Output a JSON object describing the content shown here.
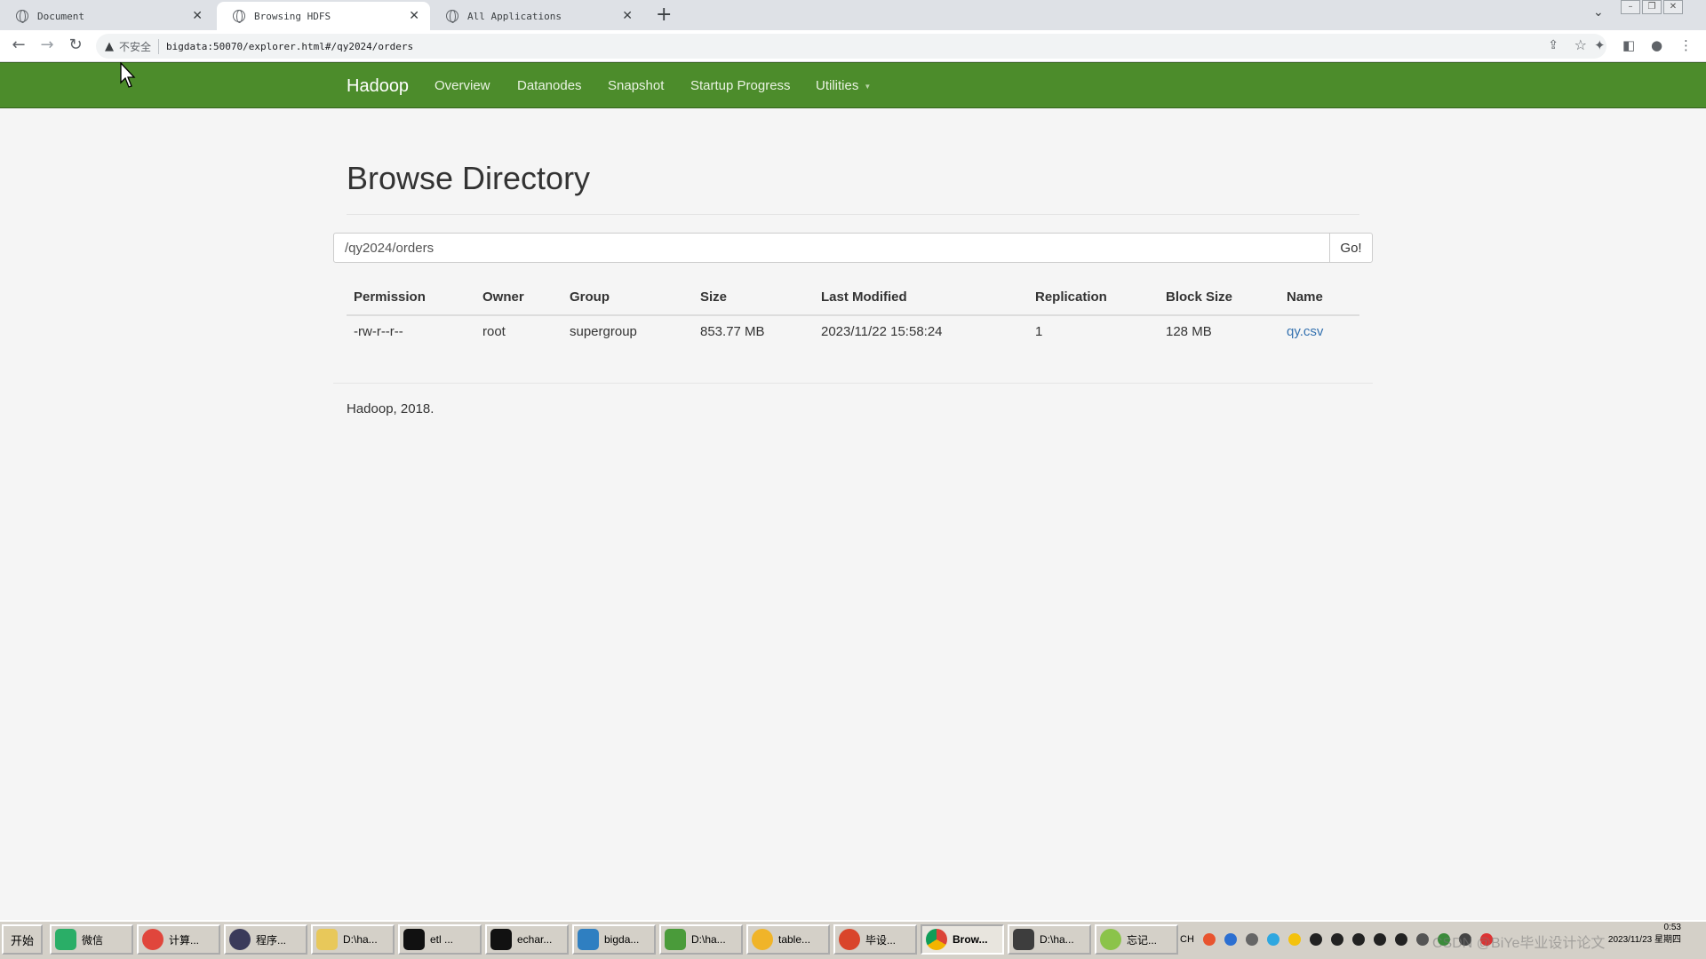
{
  "browser": {
    "tabs": [
      {
        "label": "Document"
      },
      {
        "label": "Browsing HDFS"
      },
      {
        "label": "All Applications"
      }
    ],
    "security_label": "不安全",
    "url": "bigdata:50070/explorer.html#/qy2024/orders"
  },
  "navbar": {
    "brand": "Hadoop",
    "items": [
      "Overview",
      "Datanodes",
      "Snapshot",
      "Startup Progress",
      "Utilities"
    ],
    "accent": "#4c8c2b"
  },
  "page": {
    "title": "Browse Directory",
    "path_value": "/qy2024/orders",
    "go_label": "Go!"
  },
  "table": {
    "headers": [
      "Permission",
      "Owner",
      "Group",
      "Size",
      "Last Modified",
      "Replication",
      "Block Size",
      "Name"
    ],
    "rows": [
      {
        "permission": "-rw-r--r--",
        "owner": "root",
        "group": "supergroup",
        "size": "853.77 MB",
        "last_modified": "2023/11/22 15:58:24",
        "replication": "1",
        "block_size": "128 MB",
        "name": "qy.csv"
      }
    ]
  },
  "footer": "Hadoop, 2018.",
  "taskbar": {
    "start": "开始",
    "tasks": [
      "微信",
      "计算...",
      "程序...",
      "D:\\ha...",
      "etl ...",
      "echar...",
      "bigda...",
      "D:\\ha...",
      "table...",
      "毕设...",
      "Brow...",
      "D:\\ha...",
      "忘记..."
    ],
    "tray_lang": "CH",
    "clock_time": "0:53",
    "clock_date": "2023/11/23 星期四",
    "watermark": "CSDN @BiYe毕业设计论文"
  }
}
